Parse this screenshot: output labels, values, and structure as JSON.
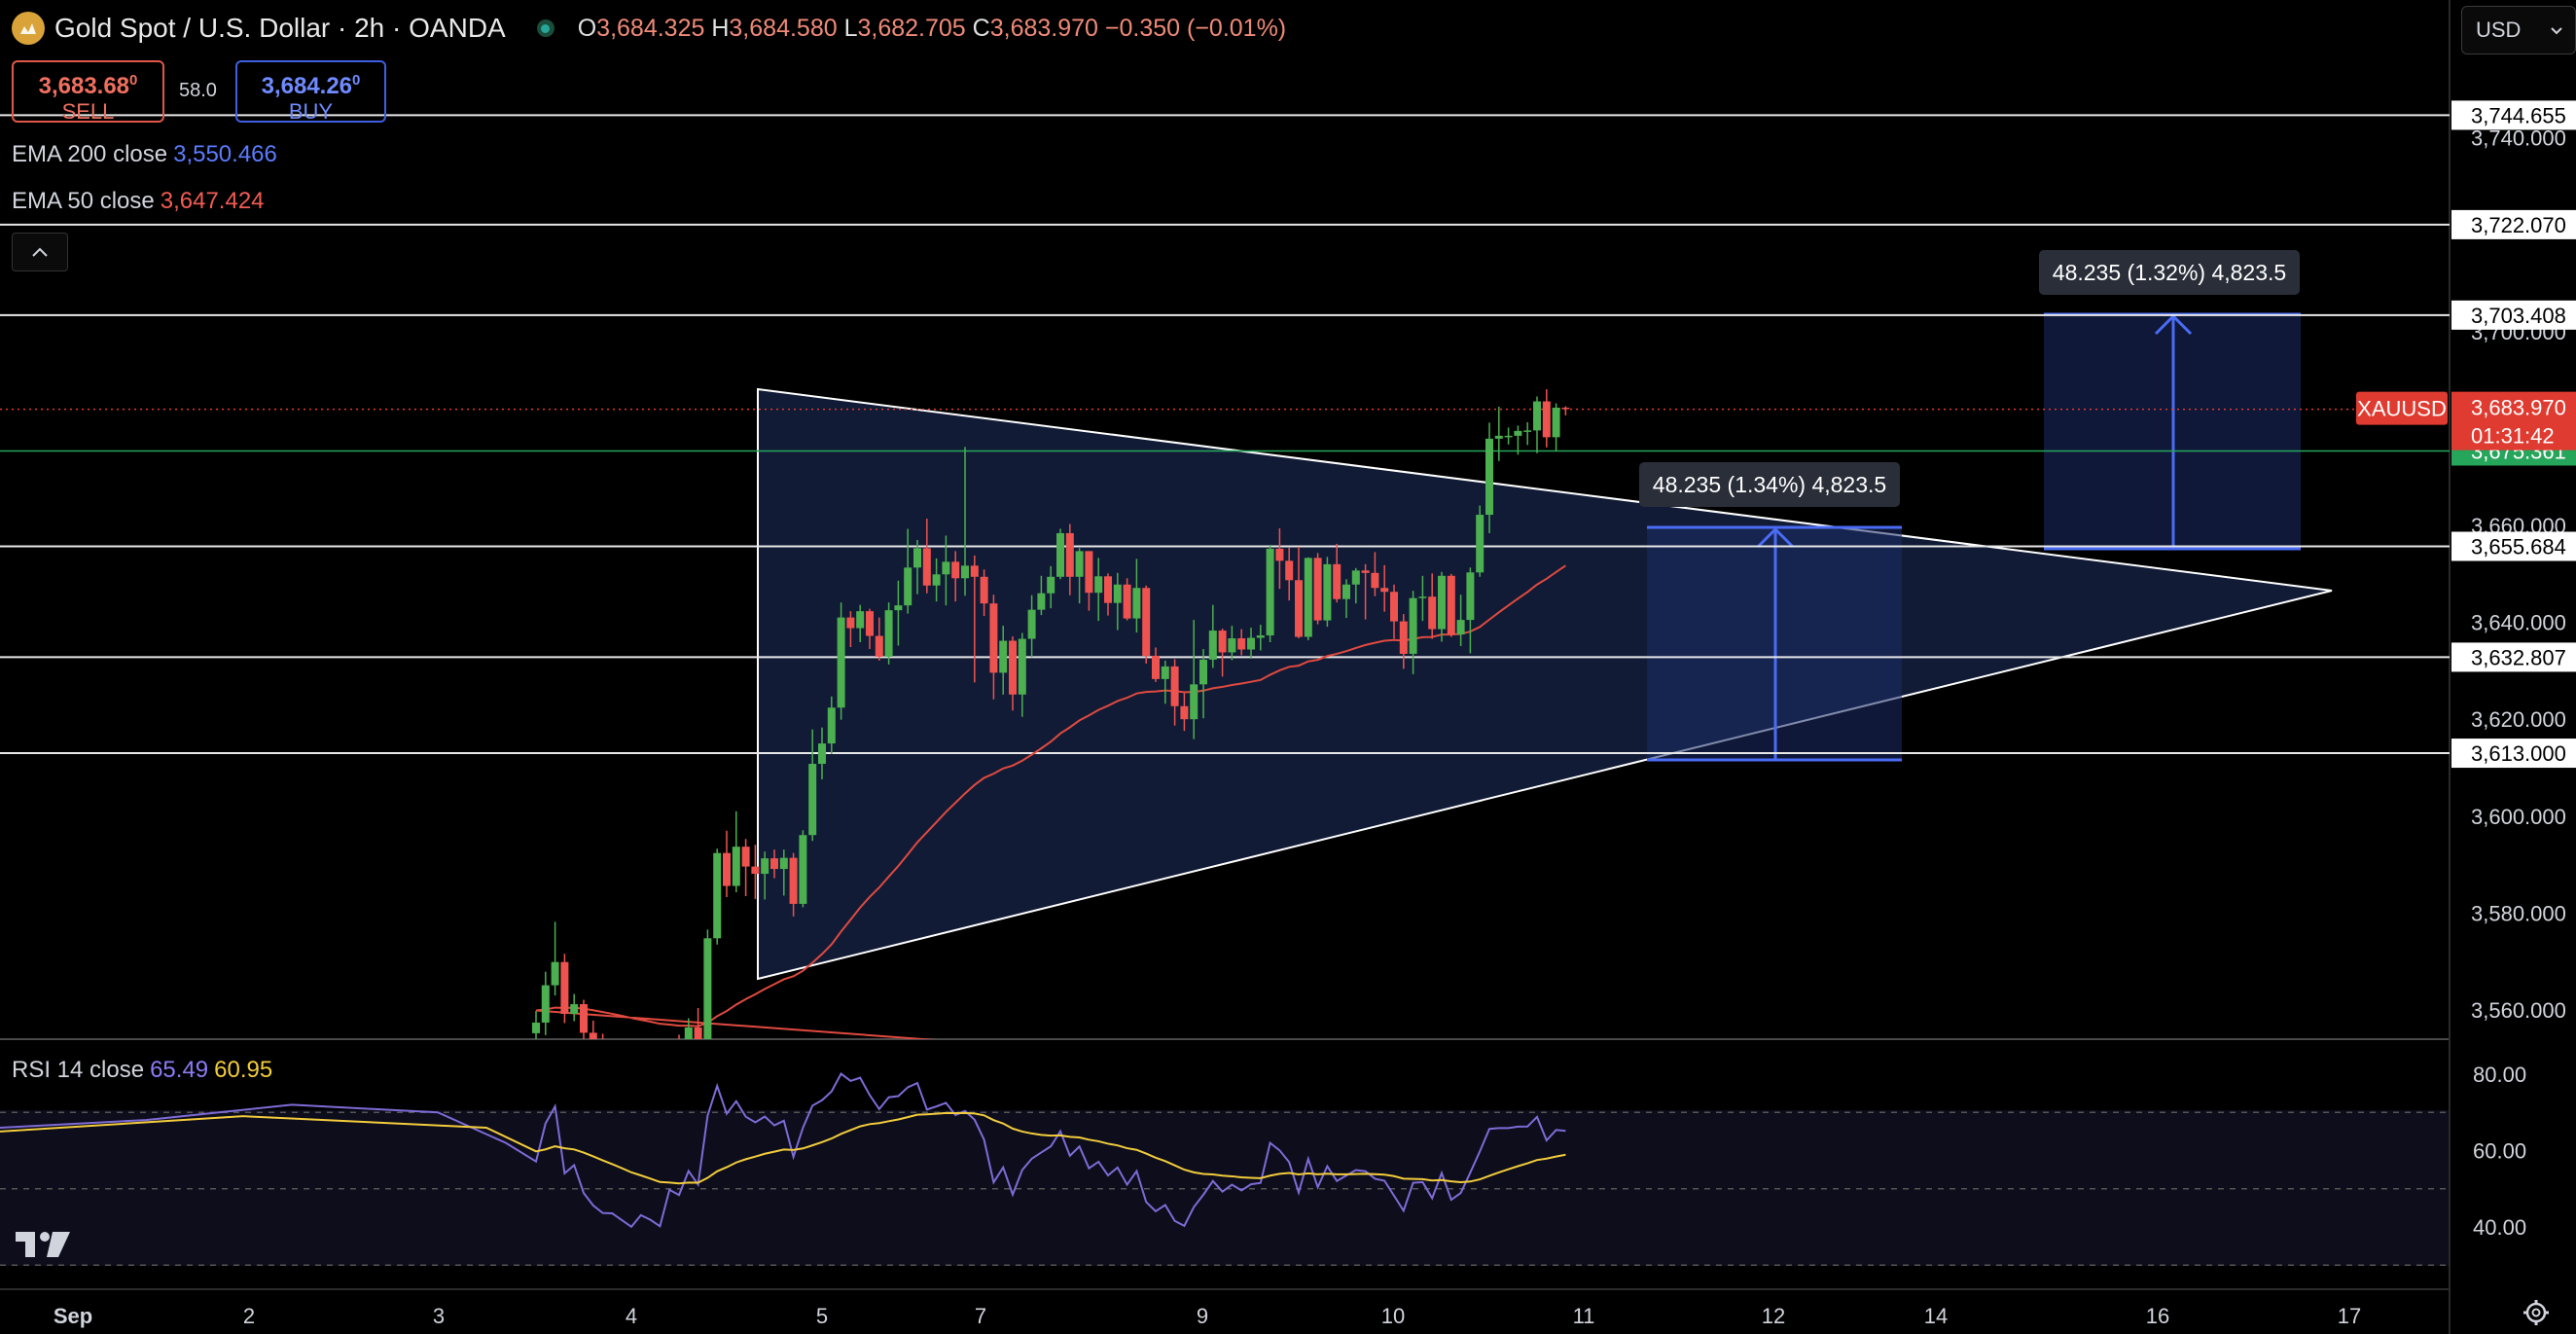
{
  "header": {
    "symbol_title": "Gold Spot / U.S. Dollar · 2h · OANDA",
    "ohlc": {
      "o_label": "O",
      "o": "3,684.325",
      "h_label": "H",
      "h": "3,684.580",
      "l_label": "L",
      "l": "3,682.705",
      "c_label": "C",
      "c": "3,683.970",
      "change": "−0.350 (−0.01%)"
    },
    "sell_price": "3,683.68",
    "sell_sup": "0",
    "sell_label": "SELL",
    "spread": "58.0",
    "buy_price": "3,684.26",
    "buy_sup": "0",
    "buy_label": "BUY",
    "currency": "USD"
  },
  "indicators": {
    "ema200_label": "EMA 200 close",
    "ema200_value": "3,550.466",
    "ema50_label": "EMA 50 close",
    "ema50_value": "3,647.424",
    "rsi_label": "RSI 14 close",
    "rsi_value": "65.49",
    "rsi_ma_value": "60.95"
  },
  "colors": {
    "up": "#4caf50",
    "down": "#ef5350",
    "ema50": "#e04a3f",
    "rsi": "#7e6bd6",
    "rsi_ma": "#f2cc3c",
    "price_tag_red": "#e03b30",
    "price_tag_green": "#26a65b",
    "measure": "#4a6cf5",
    "triangle_fill": "#172448"
  },
  "chart_data": {
    "type": "candlestick",
    "symbol": "XAUUSD",
    "timeframe": "2h",
    "y_axis_ticks": [
      "3,560.000",
      "3,580.000",
      "3,600.000",
      "3,620.000",
      "3,640.000",
      "3,660.000",
      "3,740.000",
      "3,700.000"
    ],
    "y_axis_values": [
      3560,
      3580,
      3600,
      3620,
      3640,
      3660,
      3740,
      3700
    ],
    "x_axis_ticks": [
      "Sep",
      "2",
      "3",
      "4",
      "5",
      "7",
      "9",
      "10",
      "11",
      "12",
      "14",
      "16",
      "17"
    ],
    "horizontal_levels": [
      {
        "label": "3,744.655",
        "value": 3744.655
      },
      {
        "label": "3,722.070",
        "value": 3722.07
      },
      {
        "label": "3,703.408",
        "value": 3703.408
      },
      {
        "label": "3,655.684",
        "value": 3655.684
      },
      {
        "label": "3,632.807",
        "value": 3632.807
      },
      {
        "label": "3,613.000",
        "value": 3613.0
      }
    ],
    "last_price": {
      "symbol": "XAUUSD",
      "value": 3683.97,
      "label": "3,683.970",
      "countdown": "01:31:42"
    },
    "green_level": {
      "value": 3675.361,
      "label": "3,675.361"
    },
    "measure_labels": [
      "48.235 (1.34%) 4,823.5",
      "48.235 (1.32%) 4,823.5"
    ],
    "ema50_value": 3647.424,
    "rsi": {
      "levels": [
        70,
        50,
        30
      ],
      "tick_labels": [
        "80.00",
        "60.00",
        "40.00"
      ],
      "last": 65.49,
      "ma_last": 60.95
    },
    "candles": [
      [
        3555.2,
        3559.8,
        3551.5,
        3557.4
      ],
      [
        3557.4,
        3567.9,
        3554.8,
        3565.1
      ],
      [
        3565.1,
        3578.2,
        3563.0,
        3569.9
      ],
      [
        3569.9,
        3571.6,
        3557.3,
        3559.2
      ],
      [
        3559.2,
        3563.3,
        3557.7,
        3561.2
      ],
      [
        3561.2,
        3562.1,
        3553.8,
        3555.3
      ],
      [
        3555.3,
        3557.8,
        3551.1,
        3552.3
      ],
      [
        3552.3,
        3555.1,
        3549.1,
        3550.4
      ],
      [
        3550.4,
        3553.9,
        3547.5,
        3550.3
      ],
      [
        3550.3,
        3552.6,
        3546.7,
        3548.7
      ],
      [
        3548.7,
        3551.3,
        3544.9,
        3547.1
      ],
      [
        3547.1,
        3551.6,
        3545.7,
        3549.0
      ],
      [
        3549.0,
        3550.2,
        3546.2,
        3548.0
      ],
      [
        3548.0,
        3551.5,
        3544.9,
        3546.6
      ],
      [
        3546.6,
        3553.8,
        3545.6,
        3552.7
      ],
      [
        3552.7,
        3554.9,
        3550.3,
        3551.7
      ],
      [
        3551.7,
        3558.3,
        3549.4,
        3556.4
      ],
      [
        3556.4,
        3560.4,
        3549.5,
        3553.9
      ],
      [
        3553.9,
        3576.6,
        3552.7,
        3574.8
      ],
      [
        3574.8,
        3593.3,
        3573.5,
        3592.4
      ],
      [
        3592.4,
        3597.0,
        3583.3,
        3585.6
      ],
      [
        3585.6,
        3601.0,
        3584.3,
        3593.7
      ],
      [
        3593.7,
        3595.3,
        3583.5,
        3589.6
      ],
      [
        3589.6,
        3594.1,
        3582.9,
        3588.1
      ],
      [
        3588.1,
        3592.7,
        3582.8,
        3591.3
      ],
      [
        3591.3,
        3593.1,
        3587.2,
        3589.1
      ],
      [
        3589.1,
        3593.1,
        3583.6,
        3591.4
      ],
      [
        3591.4,
        3592.4,
        3579.3,
        3581.9
      ],
      [
        3581.9,
        3597.1,
        3581.2,
        3596.1
      ],
      [
        3596.1,
        3617.9,
        3594.9,
        3610.8
      ],
      [
        3610.8,
        3618.3,
        3607.6,
        3615.0
      ],
      [
        3615.0,
        3624.7,
        3612.8,
        3622.4
      ],
      [
        3622.4,
        3644.1,
        3619.9,
        3641.0
      ],
      [
        3641.0,
        3642.3,
        3634.9,
        3638.8
      ],
      [
        3638.8,
        3643.6,
        3635.9,
        3642.3
      ],
      [
        3642.3,
        3642.8,
        3634.5,
        3637.2
      ],
      [
        3637.2,
        3641.0,
        3632.1,
        3632.9
      ],
      [
        3632.9,
        3644.1,
        3631.3,
        3642.5
      ],
      [
        3642.5,
        3648.6,
        3635.2,
        3643.5
      ],
      [
        3643.5,
        3659.3,
        3641.8,
        3651.3
      ],
      [
        3651.3,
        3657.0,
        3645.8,
        3655.3
      ],
      [
        3655.3,
        3661.4,
        3646.0,
        3647.6
      ],
      [
        3647.6,
        3653.2,
        3644.3,
        3649.9
      ],
      [
        3649.9,
        3657.9,
        3643.5,
        3652.5
      ],
      [
        3652.5,
        3654.7,
        3644.3,
        3649.1
      ],
      [
        3649.1,
        3676.2,
        3645.5,
        3651.7
      ],
      [
        3651.7,
        3653.8,
        3627.6,
        3649.4
      ],
      [
        3649.4,
        3650.9,
        3641.3,
        3643.9
      ],
      [
        3643.9,
        3645.7,
        3624.1,
        3629.6
      ],
      [
        3629.6,
        3639.3,
        3625.1,
        3636.2
      ],
      [
        3636.2,
        3637.1,
        3621.8,
        3625.1
      ],
      [
        3625.1,
        3637.8,
        3620.5,
        3636.6
      ],
      [
        3636.6,
        3645.6,
        3632.8,
        3642.6
      ],
      [
        3642.6,
        3649.6,
        3641.5,
        3646.0
      ],
      [
        3646.0,
        3651.6,
        3642.9,
        3649.4
      ],
      [
        3649.4,
        3659.3,
        3648.9,
        3658.4
      ],
      [
        3658.4,
        3660.3,
        3645.6,
        3649.4
      ],
      [
        3649.4,
        3655.3,
        3643.9,
        3654.7
      ],
      [
        3654.7,
        3654.7,
        3642.4,
        3646.1
      ],
      [
        3646.1,
        3653.3,
        3640.3,
        3649.5
      ],
      [
        3649.5,
        3650.1,
        3641.4,
        3644.0
      ],
      [
        3644.0,
        3650.2,
        3638.4,
        3647.8
      ],
      [
        3647.8,
        3649.1,
        3640.4,
        3640.8
      ],
      [
        3640.8,
        3653.1,
        3637.9,
        3647.1
      ],
      [
        3647.1,
        3647.6,
        3631.5,
        3633.1
      ],
      [
        3633.1,
        3634.8,
        3627.7,
        3628.3
      ],
      [
        3628.3,
        3632.1,
        3623.2,
        3630.9
      ],
      [
        3630.9,
        3632.4,
        3618.7,
        3622.7
      ],
      [
        3622.7,
        3625.4,
        3617.6,
        3620.0
      ],
      [
        3620.0,
        3640.5,
        3615.9,
        3627.2
      ],
      [
        3627.2,
        3634.5,
        3620.2,
        3632.3
      ],
      [
        3632.3,
        3643.6,
        3630.6,
        3638.3
      ],
      [
        3638.3,
        3638.7,
        3628.8,
        3633.8
      ],
      [
        3633.8,
        3639.3,
        3632.2,
        3636.7
      ],
      [
        3636.7,
        3638.6,
        3633.2,
        3634.4
      ],
      [
        3634.4,
        3638.9,
        3632.5,
        3636.8
      ],
      [
        3636.8,
        3639.5,
        3634.2,
        3637.3
      ],
      [
        3637.3,
        3656.0,
        3635.9,
        3655.2
      ],
      [
        3655.2,
        3659.4,
        3646.9,
        3652.7
      ],
      [
        3652.7,
        3655.4,
        3644.5,
        3648.7
      ],
      [
        3648.7,
        3655.6,
        3636.7,
        3637.0
      ],
      [
        3637.0,
        3653.4,
        3636.3,
        3653.3
      ],
      [
        3653.3,
        3654.3,
        3639.6,
        3640.4
      ],
      [
        3640.4,
        3653.5,
        3639.1,
        3652.0
      ],
      [
        3652.0,
        3656.2,
        3644.1,
        3644.8
      ],
      [
        3644.8,
        3648.9,
        3640.9,
        3647.8
      ],
      [
        3647.8,
        3651.2,
        3643.9,
        3650.7
      ],
      [
        3650.7,
        3652.0,
        3640.6,
        3650.2
      ],
      [
        3650.2,
        3654.5,
        3645.4,
        3647.1
      ],
      [
        3647.1,
        3651.8,
        3642.2,
        3646.3
      ],
      [
        3646.3,
        3647.8,
        3636.6,
        3640.2
      ],
      [
        3640.2,
        3641.7,
        3630.4,
        3633.5
      ],
      [
        3633.5,
        3646.5,
        3629.3,
        3645.0
      ],
      [
        3645.0,
        3649.6,
        3640.3,
        3645.3
      ],
      [
        3645.3,
        3650.1,
        3636.6,
        3638.6
      ],
      [
        3638.6,
        3650.4,
        3636.0,
        3649.6
      ],
      [
        3649.6,
        3650.0,
        3637.0,
        3637.5
      ],
      [
        3637.5,
        3645.7,
        3635.1,
        3640.5
      ],
      [
        3640.5,
        3651.3,
        3633.6,
        3650.3
      ],
      [
        3650.3,
        3664.1,
        3649.4,
        3662.2
      ],
      [
        3662.2,
        3681.2,
        3658.4,
        3677.9
      ],
      [
        3677.9,
        3684.5,
        3673.3,
        3678.5
      ],
      [
        3678.5,
        3680.2,
        3676.7,
        3678.5
      ],
      [
        3678.5,
        3680.6,
        3674.6,
        3679.5
      ],
      [
        3679.5,
        3681.3,
        3676.6,
        3679.6
      ],
      [
        3679.6,
        3686.6,
        3674.9,
        3685.6
      ],
      [
        3685.6,
        3688.1,
        3676.1,
        3678.2
      ],
      [
        3678.2,
        3685.2,
        3675.3,
        3684.3
      ],
      [
        3684.3,
        3684.6,
        3682.7,
        3684.0
      ]
    ]
  }
}
